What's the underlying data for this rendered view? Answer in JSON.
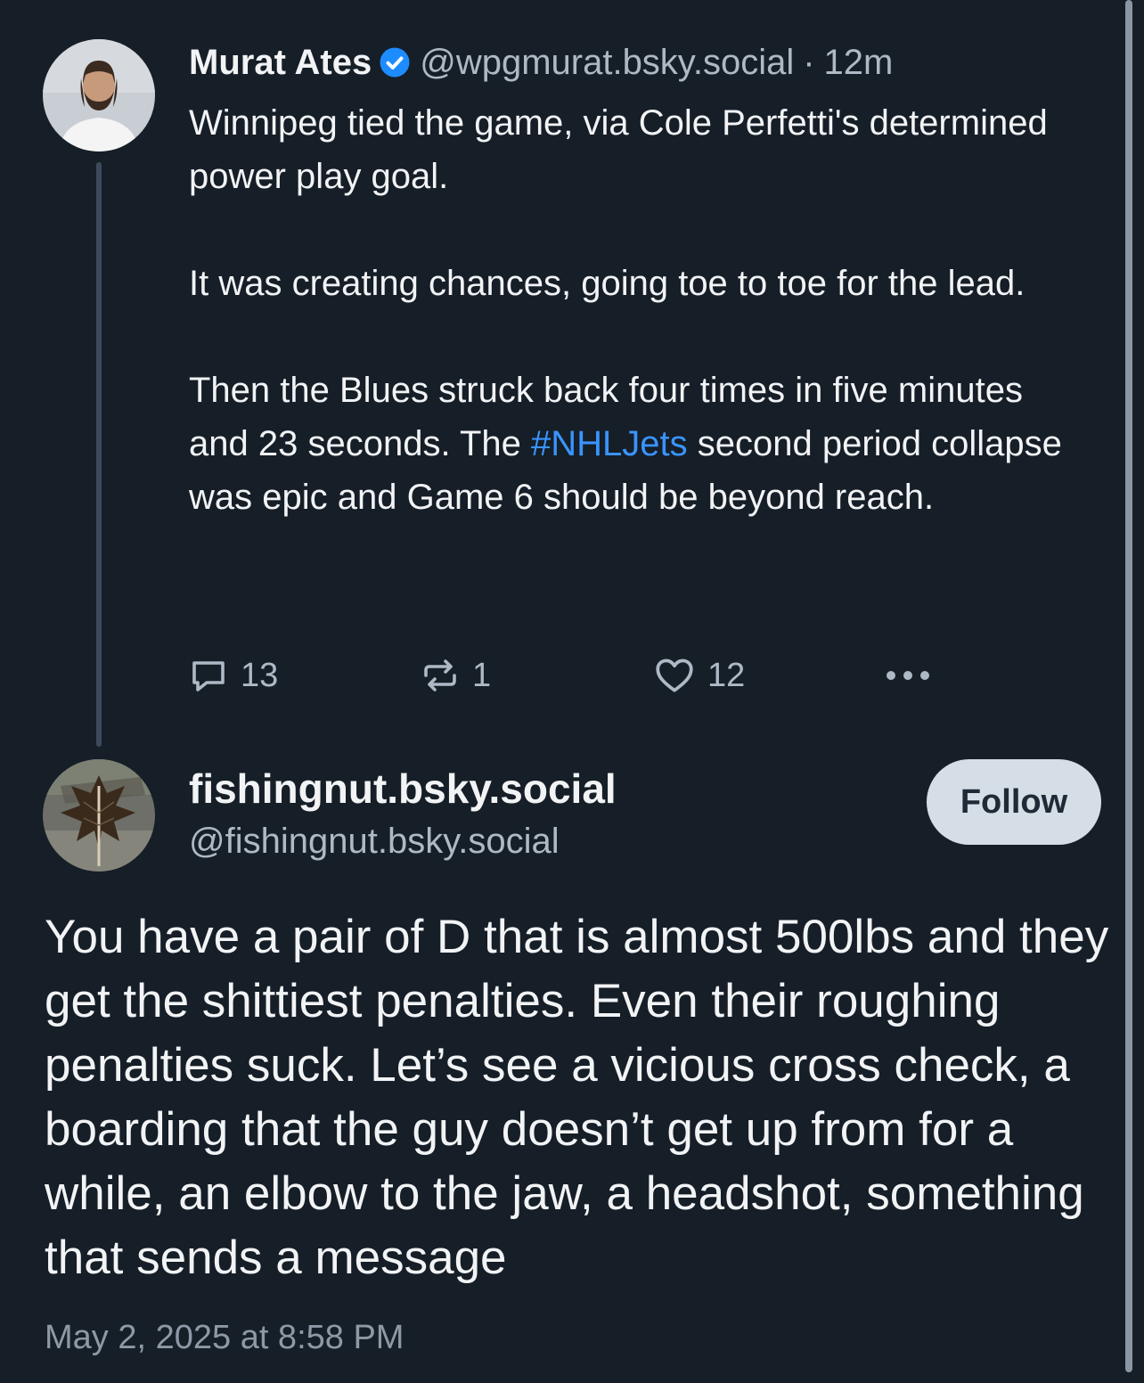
{
  "parent_post": {
    "author": {
      "display_name": "Murat Ates",
      "handle": "@wpgmurat.bsky.social",
      "verified_icon": "verified-badge-icon",
      "avatar_icon": "avatar-photo"
    },
    "separator": "·",
    "time_ago": "12m",
    "text": {
      "p1": "Winnipeg tied the game, via Cole Perfetti's determined power play goal.",
      "p2": "It was creating chances, going toe to toe for the lead.",
      "p3_before": "Then the Blues struck back four times in five minutes and 23 seconds. The ",
      "p3_hashtag": "#NHLJets",
      "p3_after": " second period collapse was epic and Game 6 should be beyond reach."
    },
    "stats": {
      "replies": "13",
      "reposts": "1",
      "likes": "12"
    }
  },
  "reply_post": {
    "author": {
      "display_name": "fishingnut.bsky.social",
      "handle": "@fishingnut.bsky.social",
      "avatar_icon": "leaf-avatar-photo"
    },
    "follow_label": "Follow",
    "text": "You have a pair of D that is almost 500lbs and they get the shittiest penalties. Even their roughing penalties suck. Let’s see a vicious cross check, a boarding that the guy doesn’t get up from for a while, an elbow to the jaw, a headshot, something that sends a message",
    "timestamp": "May 2, 2025 at 8:58 PM"
  },
  "colors": {
    "background": "#161e27",
    "text_primary": "#f1f3f5",
    "text_secondary": "#aeb9c6",
    "link": "#3a94ff",
    "follow_button": "#d5dde7"
  }
}
